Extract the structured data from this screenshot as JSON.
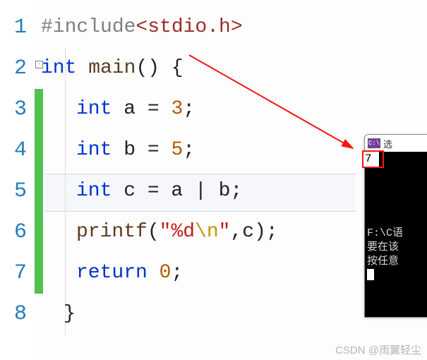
{
  "gutter": [
    "1",
    "2",
    "3",
    "4",
    "5",
    "6",
    "7",
    "8"
  ],
  "code": {
    "l1": {
      "pre": "#include",
      "inc": "<stdio.h>"
    },
    "l2": {
      "kw": "int ",
      "fn": "main",
      "rest": "() {"
    },
    "l3": {
      "kw": "int ",
      "v": "a = ",
      "n": "3",
      "end": ";"
    },
    "l4": {
      "kw": "int ",
      "v": "b = ",
      "n": "5",
      "end": ";"
    },
    "l5": {
      "kw": "int ",
      "v": "c = a | b;"
    },
    "l6": {
      "fn": "printf",
      "p1": "(",
      "s1": "\"%d",
      "esc": "\\n",
      "s2": "\"",
      "p2": ",c);"
    },
    "l7": {
      "kw": "return ",
      "n": "0",
      "end": ";"
    },
    "l8": {
      "brace": "}"
    }
  },
  "console": {
    "title": "选",
    "icon_text": "C:\\",
    "output": "7",
    "body_l1": "F:\\C语",
    "body_l2": "要在该",
    "body_l3": "按任意"
  },
  "watermark": "CSDN @雨翼轻尘"
}
